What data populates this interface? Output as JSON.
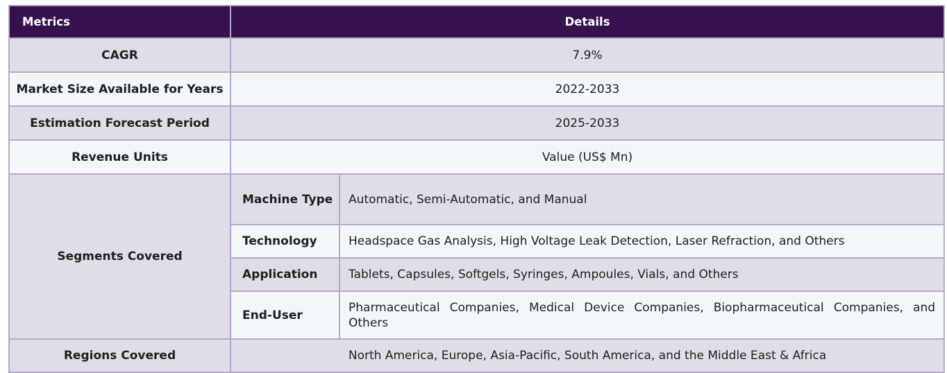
{
  "table": {
    "headers": {
      "metrics": "Metrics",
      "details": "Details"
    },
    "rows": [
      {
        "metric": "CAGR",
        "value": "7.9%"
      },
      {
        "metric": "Market Size Available for Years",
        "value": "2022-2033"
      },
      {
        "metric": "Estimation Forecast Period",
        "value": "2025-2033"
      },
      {
        "metric": "Revenue Units",
        "value": "Value (US$ Mn)"
      }
    ],
    "segments": {
      "label": "Segments Covered",
      "items": [
        {
          "name": "Machine Type",
          "value": "Automatic, Semi-Automatic, and Manual"
        },
        {
          "name": "Technology",
          "value": "Headspace Gas Analysis, High Voltage Leak Detection, Laser Refraction, and Others"
        },
        {
          "name": "Application",
          "value": "Tablets, Capsules, Softgels, Syringes, Ampoules, Vials, and Others"
        },
        {
          "name": "End-User",
          "value": "Pharmaceutical Companies, Medical Device Companies, Biopharmaceutical Companies, and Others"
        }
      ]
    },
    "regions": {
      "label": "Regions Covered",
      "value": "North America, Europe, Asia-Pacific, South America, and the Middle East & Africa"
    }
  },
  "colors": {
    "header_bg": "#37114e",
    "row_shade": "#e0dde8",
    "row_light": "#f3f7fa",
    "border": "#b2a8cb"
  }
}
